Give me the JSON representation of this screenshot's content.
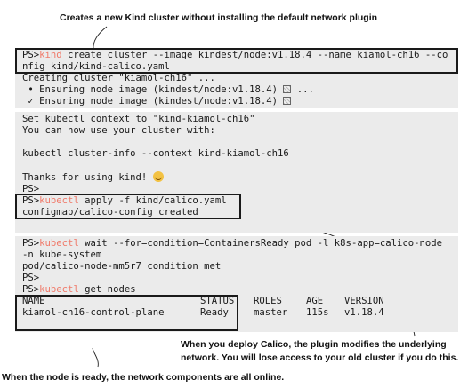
{
  "callouts": {
    "top": "Creates a new Kind cluster without installing the default network plugin",
    "right_1": "When you deploy Calico, the plugin modifies the underlying",
    "right_2": "network. You will lose access to your old cluster if you do this.",
    "bottom": "When the node is ready, the network components are all online."
  },
  "block1": {
    "prompt": "PS>",
    "cmd": "kind",
    "line1_rest": " create cluster --image kindest/node:v1.18.4 --name kiamol-ch16 --co",
    "line2": "nfig kind/kind-calico.yaml",
    "line3": "Creating cluster \"kiamol-ch16\" ...",
    "line4": " • Ensuring node image (kindest/node:v1.18.4)",
    "line4_tail": " ...",
    "line5": " ✓ Ensuring node image (kindest/node:v1.18.4)"
  },
  "block2": {
    "line1": "Set kubectl context to \"kind-kiamol-ch16\"",
    "line2": "You can now use your cluster with:",
    "line3": "kubectl cluster-info --context kind-kiamol-ch16",
    "line4": "Thanks for using kind! ",
    "line5": "PS>",
    "prompt": "PS>",
    "cmd": "kubectl",
    "line6_rest": " apply -f kind/calico.yaml",
    "line7": "configmap/calico-config created"
  },
  "block3": {
    "prompt": "PS>",
    "cmd": "kubectl",
    "line1_rest": " wait --for=condition=ContainersReady pod -l k8s-app=calico-node",
    "line2": "-n kube-system",
    "line3": "pod/calico-node-mm5r7 condition met",
    "line4": "PS>",
    "line5_rest": " get nodes",
    "table": {
      "headers": [
        "NAME",
        "STATUS",
        "ROLES",
        "AGE",
        "VERSION"
      ],
      "row": [
        "kiamol-ch16-control-plane",
        "Ready",
        "master",
        "115s",
        "v1.18.4"
      ]
    }
  },
  "colors": {
    "terminal_bg": "#ebebeb",
    "command": "#f07a6a",
    "highlight_box": "#1a1a1a"
  }
}
